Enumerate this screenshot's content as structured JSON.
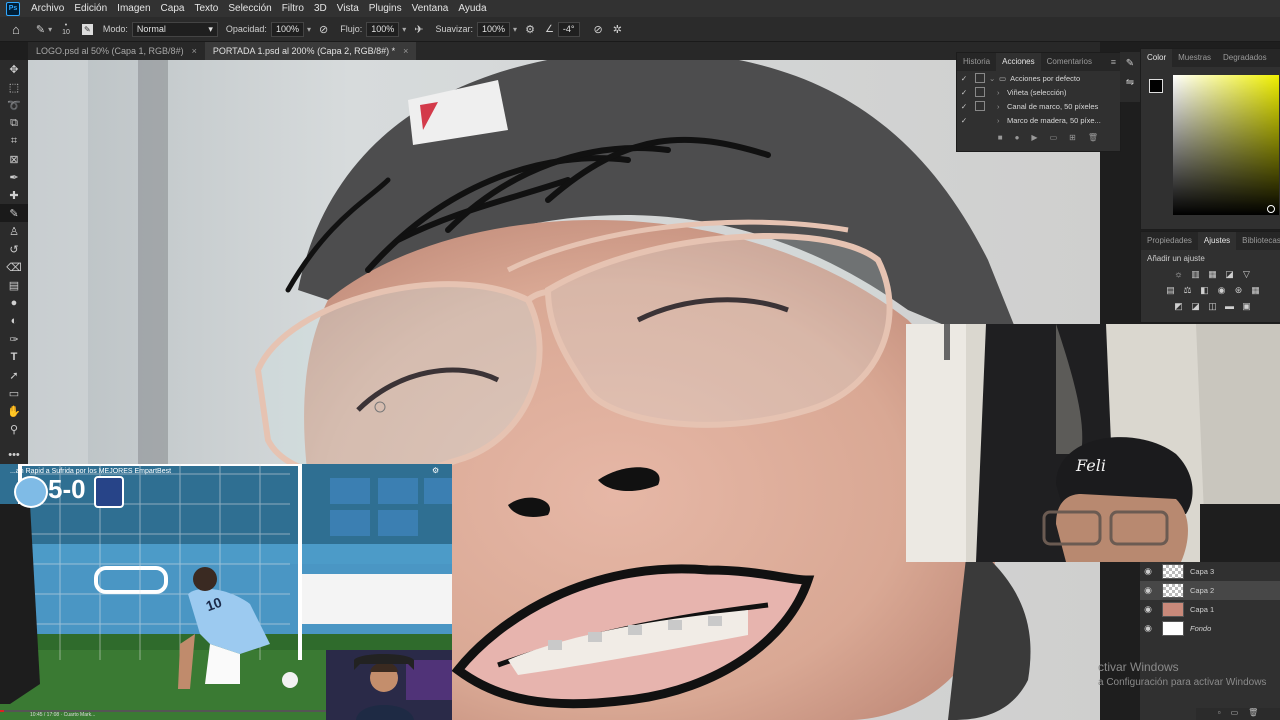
{
  "menubar": {
    "logo": "Ps",
    "items": [
      "Archivo",
      "Edición",
      "Imagen",
      "Capa",
      "Texto",
      "Selección",
      "Filtro",
      "3D",
      "Vista",
      "Plugins",
      "Ventana",
      "Ayuda"
    ]
  },
  "options": {
    "brush_size": "10",
    "mode_label": "Modo:",
    "mode_value": "Normal",
    "opacity_label": "Opacidad:",
    "opacity_value": "100%",
    "flow_label": "Flujo:",
    "flow_value": "100%",
    "smooth_label": "Suavizar:",
    "smooth_value": "100%",
    "angle_value": "-4°"
  },
  "tabs": [
    {
      "label": "LOGO.psd al 50% (Capa 1, RGB/8#)",
      "close": "×"
    },
    {
      "label": "PORTADA 1.psd al 200% (Capa 2, RGB/8#) *",
      "close": "×"
    }
  ],
  "actions_panel": {
    "tabs": [
      "Historia",
      "Acciones",
      "Comentarios"
    ],
    "rows": [
      {
        "label": "Acciones por defecto"
      },
      {
        "label": "Viñeta (selección)"
      },
      {
        "label": "Canal de marco, 50 píxeles"
      },
      {
        "label": "Marco de madera, 50 píxe..."
      }
    ]
  },
  "color_panel": {
    "tabs": [
      "Color",
      "Muestras",
      "Degradados"
    ],
    "hue_color": "#f0f000"
  },
  "adjust_panel": {
    "tabs": [
      "Propiedades",
      "Ajustes",
      "Bibliotecas"
    ],
    "add_label": "Añadir un ajuste"
  },
  "layers": [
    {
      "name": "Capa 3"
    },
    {
      "name": "Capa 2"
    },
    {
      "name": "Capa 1"
    },
    {
      "name": "Fondo"
    }
  ],
  "video_overlay": {
    "title": "...an Rapid a Sufrida por los MEJORES EmpartBest",
    "score": "5-0",
    "player_number": "10",
    "time": "10:45 / 17:08 · Cuarto Mark..."
  },
  "webcam_cap": {
    "text": "Feli"
  },
  "watermark": {
    "line1": "ctivar Windows",
    "line2": "a Configuración para activar Windows"
  }
}
